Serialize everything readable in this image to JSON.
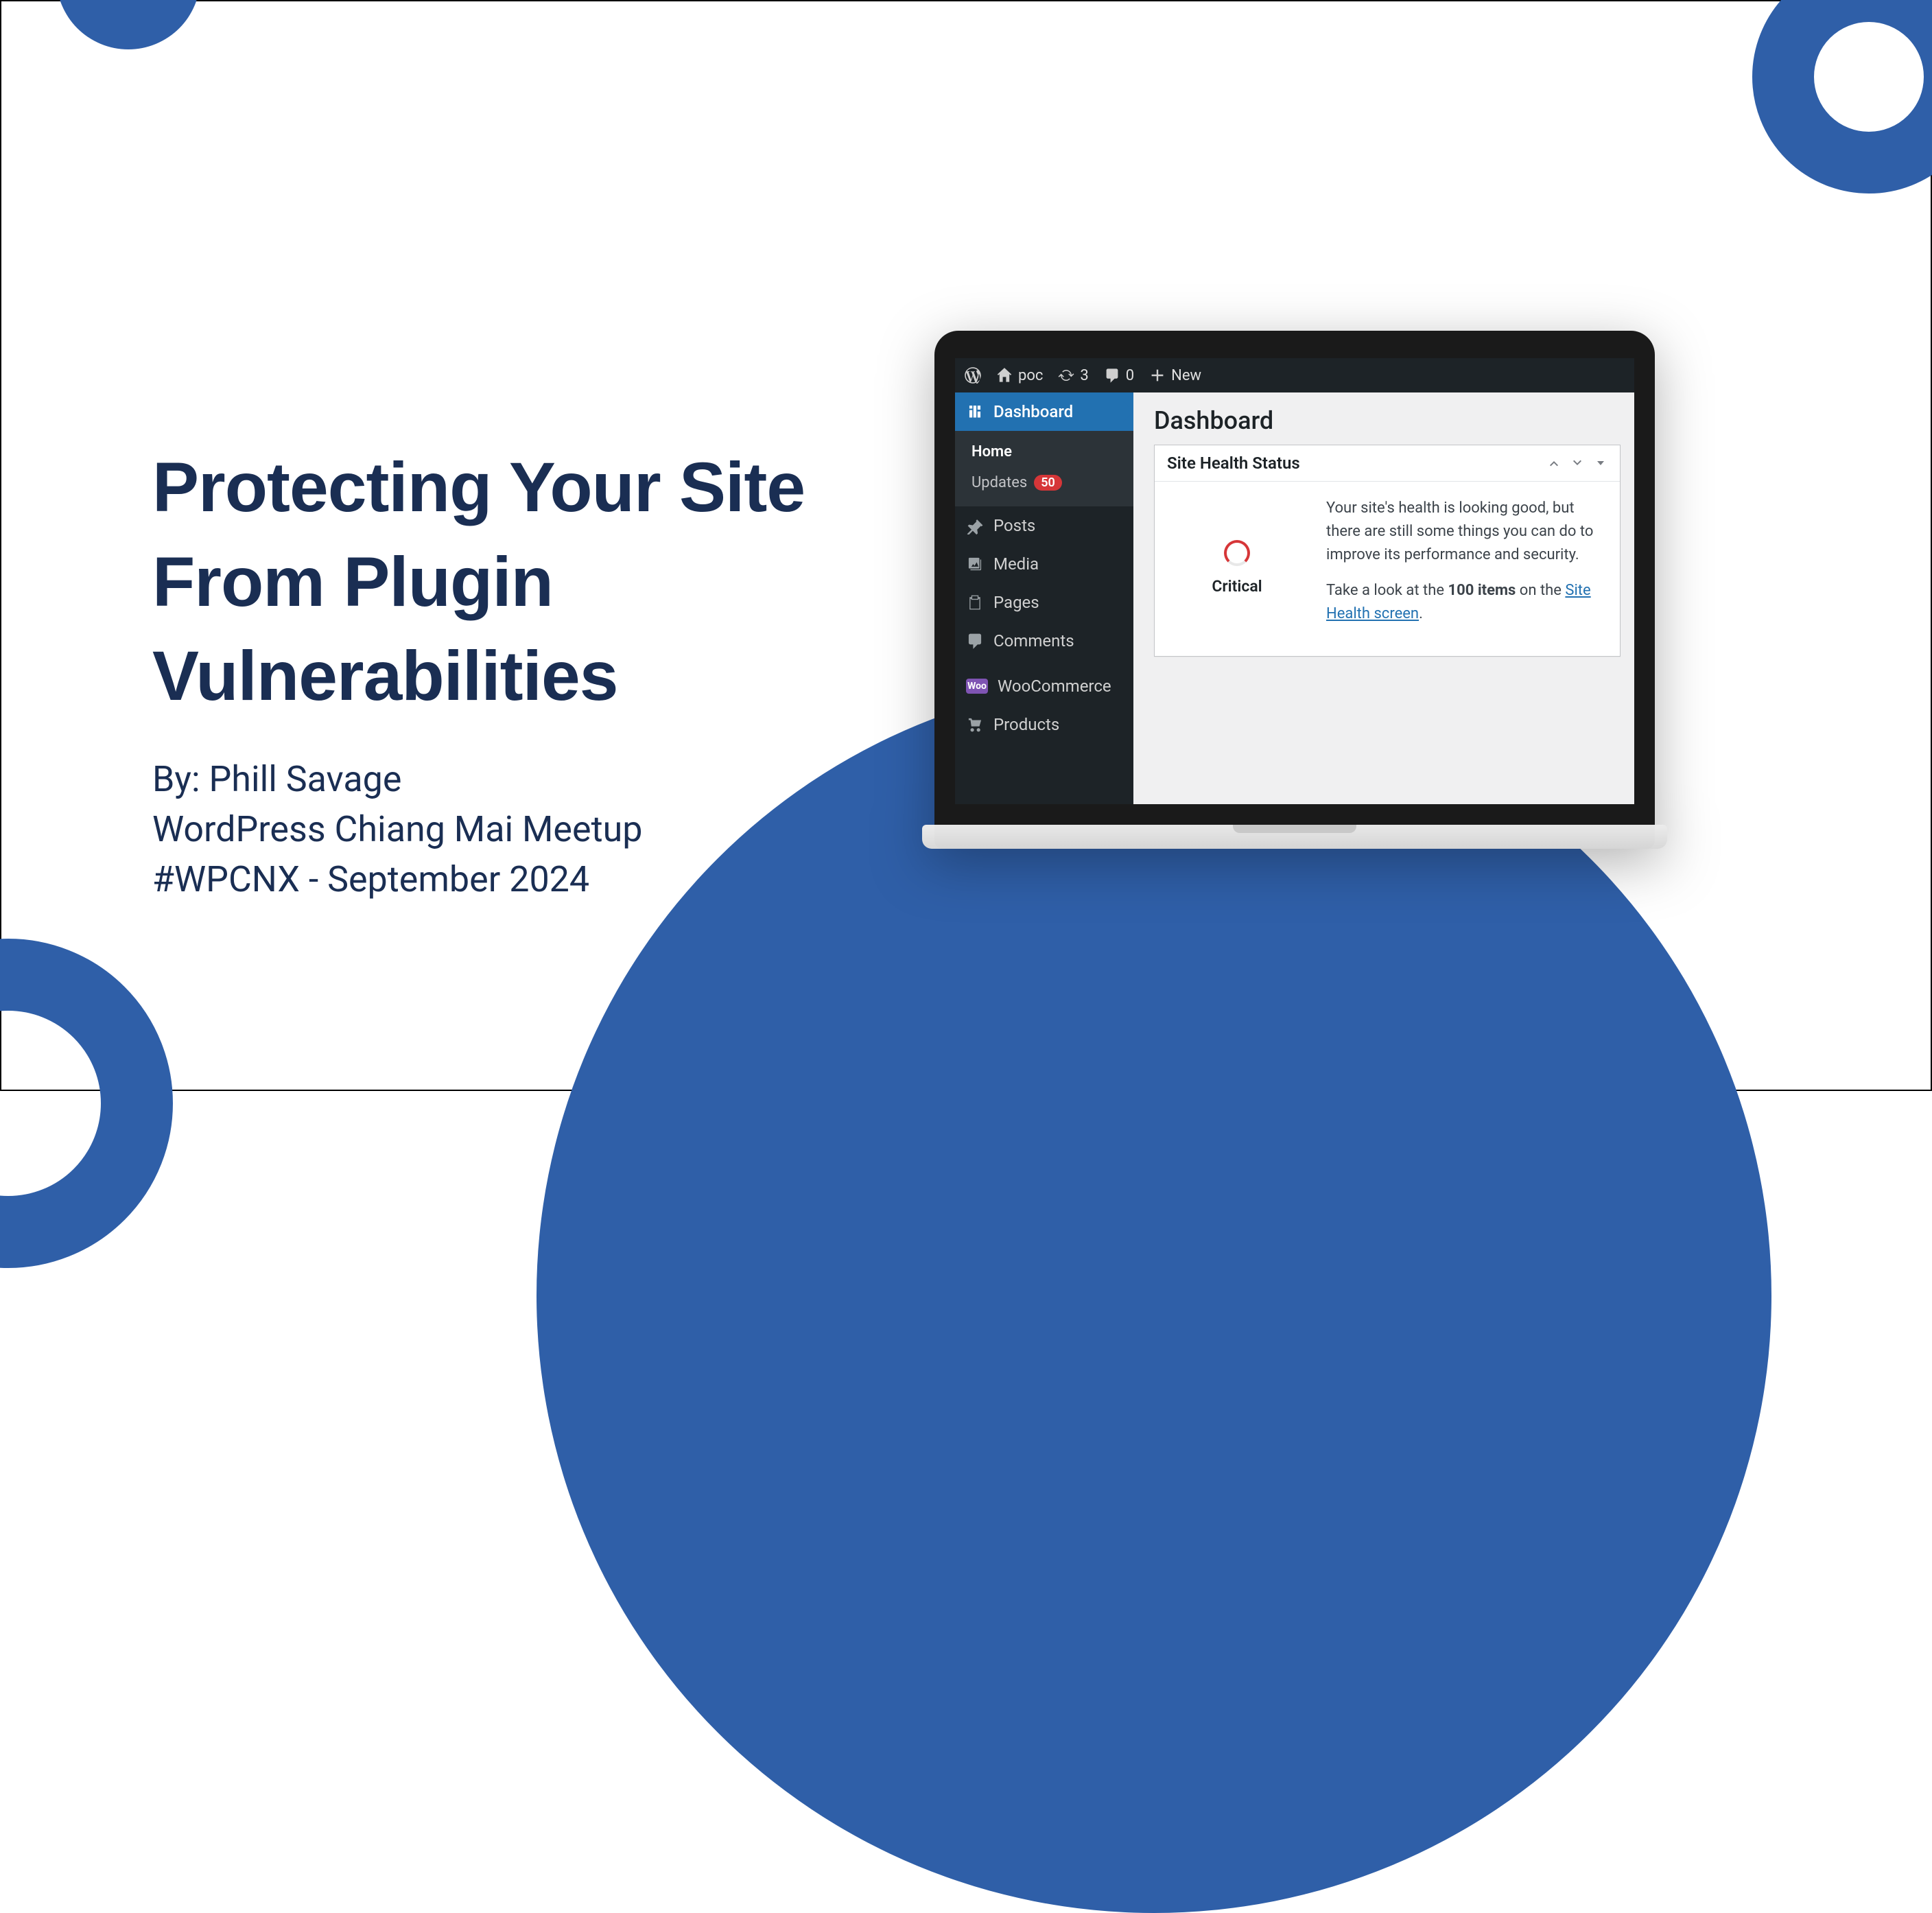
{
  "slide": {
    "title": "Protecting Your Site From Plugin Vulnerabilities",
    "byline": "By: Phill Savage",
    "event": "WordPress Chiang Mai Meetup",
    "hashtag": "#WPCNX - September 2024"
  },
  "adminbar": {
    "site_name": "poc",
    "updates": "3",
    "comments": "0",
    "new": "New"
  },
  "sidebar": {
    "dashboard": "Dashboard",
    "home": "Home",
    "updates": "Updates",
    "updates_count": "50",
    "posts": "Posts",
    "media": "Media",
    "pages": "Pages",
    "comments": "Comments",
    "woocommerce": "WooCommerce",
    "woo_badge": "Woo",
    "products": "Products"
  },
  "content": {
    "page_title": "Dashboard",
    "box_title": "Site Health Status",
    "gauge_label": "Critical",
    "health_p1": "Your site's health is looking good, but there are still some things you can do to improve its performance and security.",
    "health_p2_a": "Take a look at the ",
    "health_p2_strong": "100 items",
    "health_p2_b": " on the ",
    "health_link": "Site Health screen",
    "health_p2_c": "."
  }
}
